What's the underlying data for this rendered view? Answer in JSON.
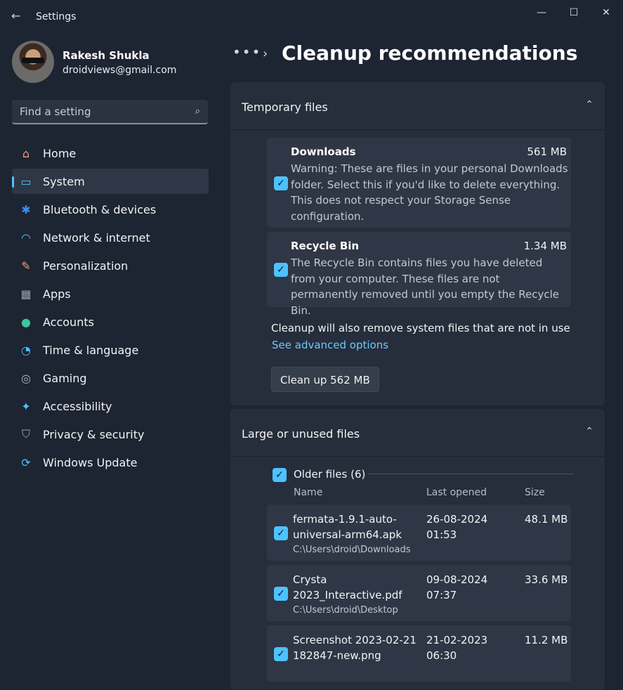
{
  "window": {
    "title": "Settings",
    "back_glyph": "←",
    "minimize_glyph": "—",
    "maximize_glyph": "☐",
    "close_glyph": "✕"
  },
  "profile": {
    "name": "Rakesh Shukla",
    "email": "droidviews@gmail.com"
  },
  "search": {
    "placeholder": "Find a setting",
    "icon": "search-icon"
  },
  "nav": {
    "items": [
      {
        "label": "Home",
        "icon": "home-icon",
        "glyph": "⌂",
        "color": "#f0a070"
      },
      {
        "label": "System",
        "icon": "system-icon",
        "glyph": "▭",
        "color": "#4cc2ff",
        "active": true
      },
      {
        "label": "Bluetooth & devices",
        "icon": "bluetooth-icon",
        "glyph": "✱",
        "color": "#3a8fe8"
      },
      {
        "label": "Network & internet",
        "icon": "wifi-icon",
        "glyph": "◠",
        "color": "#4cc2ff"
      },
      {
        "label": "Personalization",
        "icon": "brush-icon",
        "glyph": "✎",
        "color": "#f0a070"
      },
      {
        "label": "Apps",
        "icon": "apps-icon",
        "glyph": "▦",
        "color": "#9aa4b4"
      },
      {
        "label": "Accounts",
        "icon": "accounts-icon",
        "glyph": "●",
        "color": "#3cc6a0"
      },
      {
        "label": "Time & language",
        "icon": "globe-icon",
        "glyph": "◔",
        "color": "#4cc2ff"
      },
      {
        "label": "Gaming",
        "icon": "gamepad-icon",
        "glyph": "◎",
        "color": "#b0b6c0"
      },
      {
        "label": "Accessibility",
        "icon": "accessibility-icon",
        "glyph": "✦",
        "color": "#4cc2ff"
      },
      {
        "label": "Privacy & security",
        "icon": "shield-icon",
        "glyph": "⛉",
        "color": "#9aa4b4"
      },
      {
        "label": "Windows Update",
        "icon": "update-icon",
        "glyph": "⟳",
        "color": "#4cc2ff"
      }
    ]
  },
  "header": {
    "breadcrumb_more": "•••",
    "breadcrumb_chevron": "›",
    "title": "Cleanup recommendations"
  },
  "temporary": {
    "title": "Temporary files",
    "chevron": "⌃",
    "items": [
      {
        "title": "Downloads",
        "size": "561 MB",
        "desc": "Warning: These are files in your personal Downloads folder. Select this if you'd like to delete everything. This does not respect your Storage Sense configuration.",
        "checked": true
      },
      {
        "title": "Recycle Bin",
        "size": "1.34 MB",
        "desc": "The Recycle Bin contains files you have deleted from your computer. These files are not permanently removed until you empty the Recycle Bin.",
        "checked": true
      }
    ],
    "note": "Cleanup will also remove system files that are not in use",
    "link": "See advanced options",
    "button": "Clean up 562 MB"
  },
  "large": {
    "title": "Large or unused files",
    "chevron": "⌃",
    "group_label": "Older files (6)",
    "columns": {
      "name": "Name",
      "last_opened": "Last opened",
      "size": "Size"
    },
    "files": [
      {
        "name": "fermata-1.9.1-auto-universal-arm64.apk",
        "path": "C:\\Users\\droid\\Downloads",
        "last_opened": "26-08-2024 01:53",
        "size": "48.1 MB"
      },
      {
        "name": "Crysta 2023_Interactive.pdf",
        "path": "C:\\Users\\droid\\Desktop",
        "last_opened": "09-08-2024 07:37",
        "size": "33.6 MB"
      },
      {
        "name": "Screenshot 2023-02-21 182847-new.png",
        "path": "",
        "last_opened": "21-02-2023 06:30",
        "size": "11.2 MB"
      }
    ]
  },
  "check_glyph": "✓",
  "colors": {
    "accent": "#4cc2ff",
    "background": "#1d2432",
    "card": "#2f3645",
    "link": "#6cc8ff"
  }
}
